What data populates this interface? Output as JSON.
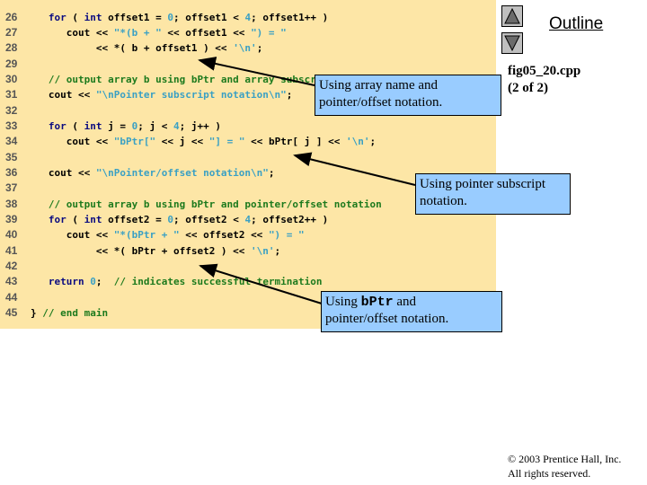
{
  "code": {
    "lines": [
      {
        "n": "26",
        "tokens": [
          [
            "indent",
            "   "
          ],
          [
            "kw",
            "for"
          ],
          [
            "plain",
            " ( "
          ],
          [
            "kw",
            "int"
          ],
          [
            "plain",
            " offset1 = "
          ],
          [
            "num",
            "0"
          ],
          [
            "plain",
            "; offset1 < "
          ],
          [
            "num",
            "4"
          ],
          [
            "plain",
            "; offset1++ )"
          ]
        ]
      },
      {
        "n": "27",
        "tokens": [
          [
            "indent",
            "      "
          ],
          [
            "plain",
            "cout << "
          ],
          [
            "str",
            "\"*(b + \""
          ],
          [
            "plain",
            " << offset1 << "
          ],
          [
            "str",
            "\") = \""
          ]
        ]
      },
      {
        "n": "28",
        "tokens": [
          [
            "indent",
            "           "
          ],
          [
            "plain",
            "<< *( b + offset1 ) << "
          ],
          [
            "str",
            "'\\n'"
          ],
          [
            "plain",
            ";"
          ]
        ]
      },
      {
        "n": "29",
        "tokens": []
      },
      {
        "n": "30",
        "tokens": [
          [
            "indent",
            "   "
          ],
          [
            "cmt",
            "// output array b using bPtr and array subscript notation"
          ]
        ]
      },
      {
        "n": "31",
        "tokens": [
          [
            "indent",
            "   "
          ],
          [
            "plain",
            "cout << "
          ],
          [
            "str",
            "\"\\nPointer subscript notation\\n\""
          ],
          [
            "plain",
            ";"
          ]
        ]
      },
      {
        "n": "32",
        "tokens": []
      },
      {
        "n": "33",
        "tokens": [
          [
            "indent",
            "   "
          ],
          [
            "kw",
            "for"
          ],
          [
            "plain",
            " ( "
          ],
          [
            "kw",
            "int"
          ],
          [
            "plain",
            " j = "
          ],
          [
            "num",
            "0"
          ],
          [
            "plain",
            "; j < "
          ],
          [
            "num",
            "4"
          ],
          [
            "plain",
            "; j++ )"
          ]
        ]
      },
      {
        "n": "34",
        "tokens": [
          [
            "indent",
            "      "
          ],
          [
            "plain",
            "cout << "
          ],
          [
            "str",
            "\"bPtr[\""
          ],
          [
            "plain",
            " << j << "
          ],
          [
            "str",
            "\"] = \""
          ],
          [
            "plain",
            " << bPtr[ j ] << "
          ],
          [
            "str",
            "'\\n'"
          ],
          [
            "plain",
            ";"
          ]
        ]
      },
      {
        "n": "35",
        "tokens": []
      },
      {
        "n": "36",
        "tokens": [
          [
            "indent",
            "   "
          ],
          [
            "plain",
            "cout << "
          ],
          [
            "str",
            "\"\\nPointer/offset notation\\n\""
          ],
          [
            "plain",
            ";"
          ]
        ]
      },
      {
        "n": "37",
        "tokens": []
      },
      {
        "n": "38",
        "tokens": [
          [
            "indent",
            "   "
          ],
          [
            "cmt",
            "// output array b using bPtr and pointer/offset notation"
          ]
        ]
      },
      {
        "n": "39",
        "tokens": [
          [
            "indent",
            "   "
          ],
          [
            "kw",
            "for"
          ],
          [
            "plain",
            " ( "
          ],
          [
            "kw",
            "int"
          ],
          [
            "plain",
            " offset2 = "
          ],
          [
            "num",
            "0"
          ],
          [
            "plain",
            "; offset2 < "
          ],
          [
            "num",
            "4"
          ],
          [
            "plain",
            "; offset2++ )"
          ]
        ]
      },
      {
        "n": "40",
        "tokens": [
          [
            "indent",
            "      "
          ],
          [
            "plain",
            "cout << "
          ],
          [
            "str",
            "\"*(bPtr + \""
          ],
          [
            "plain",
            " << offset2 << "
          ],
          [
            "str",
            "\") = \""
          ]
        ]
      },
      {
        "n": "41",
        "tokens": [
          [
            "indent",
            "           "
          ],
          [
            "plain",
            "<< *( bPtr + offset2 ) << "
          ],
          [
            "str",
            "'\\n'"
          ],
          [
            "plain",
            ";"
          ]
        ]
      },
      {
        "n": "42",
        "tokens": []
      },
      {
        "n": "43",
        "tokens": [
          [
            "indent",
            "   "
          ],
          [
            "kw",
            "return"
          ],
          [
            "plain",
            " "
          ],
          [
            "num",
            "0"
          ],
          [
            "plain",
            ";  "
          ],
          [
            "cmt",
            "// indicates successful termination"
          ]
        ]
      },
      {
        "n": "44",
        "tokens": []
      },
      {
        "n": "45",
        "tokens": [
          [
            "plain",
            "} "
          ],
          [
            "cmt",
            "// end main"
          ]
        ]
      }
    ]
  },
  "callouts": {
    "c1": {
      "line1": "Using array name and",
      "line2": "pointer/offset notation."
    },
    "c2": {
      "line1": "Using pointer subscript",
      "line2": "notation."
    },
    "c3": {
      "pre": "Using ",
      "mono": "bPtr",
      "post": " and",
      "line2": "pointer/offset notation."
    }
  },
  "nav": {
    "up_icon": "triangle-up-icon",
    "down_icon": "triangle-down-icon",
    "outline_label": "Outline"
  },
  "fig": {
    "filename": "fig05_20.cpp",
    "page": "(2 of 2)"
  },
  "footer": {
    "copyright": "© 2003 Prentice Hall, Inc.",
    "rights": "All rights reserved."
  }
}
